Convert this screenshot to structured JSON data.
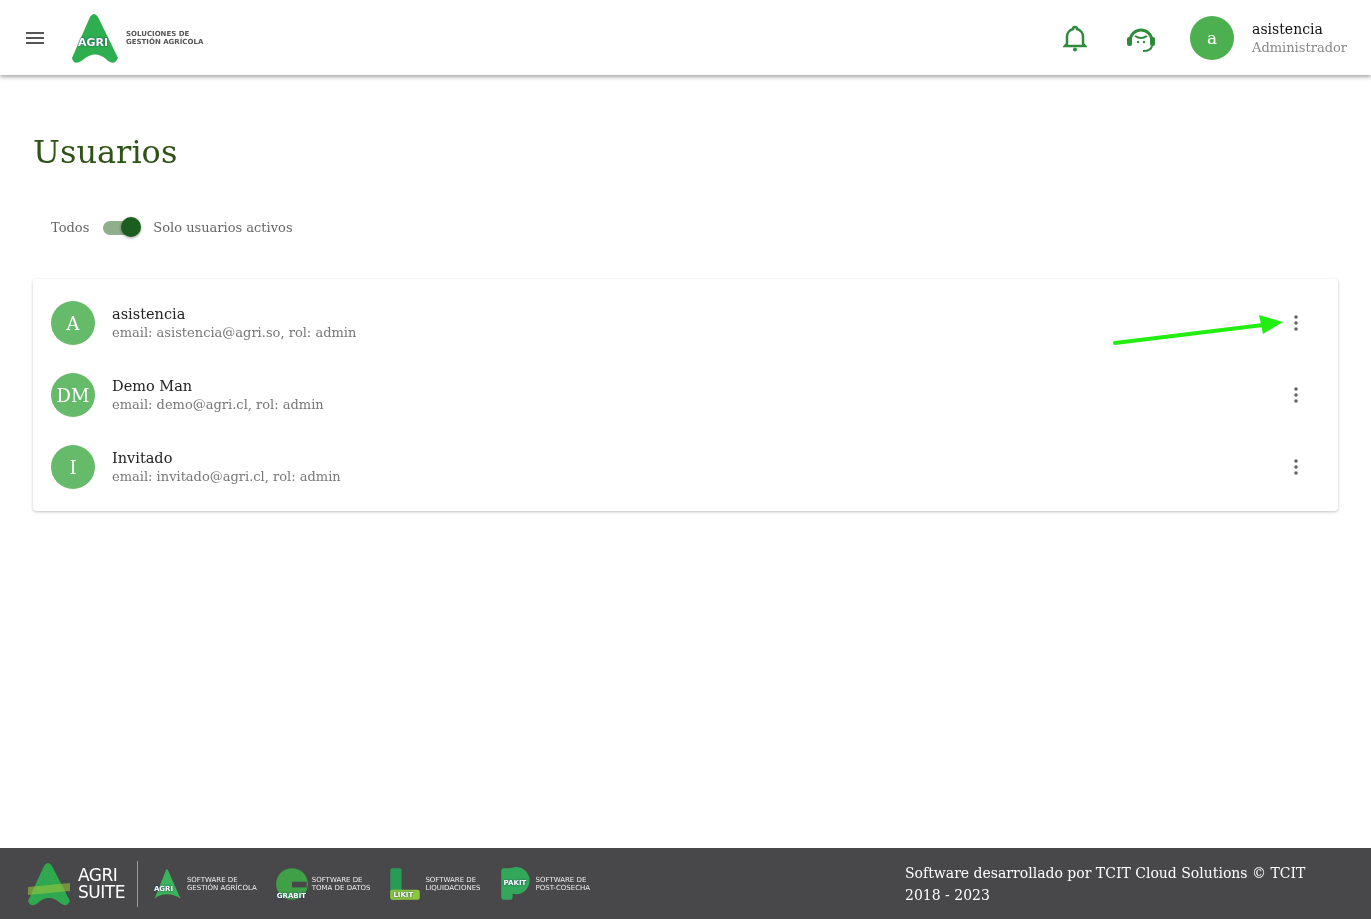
{
  "header": {
    "logo": {
      "mark": "AGRI",
      "line_1": "SOLUCIONES DE",
      "line_2": "GESTIÓN AGRÍCOLA"
    },
    "user": {
      "initial": "a",
      "name": "asistencia",
      "role": "Administrador"
    }
  },
  "page": {
    "title": "Usuarios",
    "filter": {
      "left_label": "Todos",
      "right_label": "Solo usuarios activos",
      "on": true
    }
  },
  "users": [
    {
      "initials": "A",
      "name": "asistencia",
      "details": "email: asistencia@agri.so, rol: admin"
    },
    {
      "initials": "DM",
      "name": "Demo Man",
      "details": "email: demo@agri.cl, rol: admin"
    },
    {
      "initials": "I",
      "name": "Invitado",
      "details": "email: invitado@agri.cl, rol: admin"
    }
  ],
  "footer": {
    "suite": {
      "line_1": "AGRI",
      "line_2": "SUITE"
    },
    "products": [
      {
        "mark": "AGRI",
        "line_1": "SOFTWARE DE",
        "line_2": "GESTIÓN AGRÍCOLA",
        "kind": "a"
      },
      {
        "mark": "GRABIT",
        "line_1": "SOFTWARE DE",
        "line_2": "TOMA DE DATOS",
        "kind": "g"
      },
      {
        "mark": "LIKIT",
        "line_1": "SOFTWARE DE",
        "line_2": "LIQUIDACIONES",
        "kind": "l"
      },
      {
        "mark": "PAKIT",
        "line_1": "SOFTWARE DE",
        "line_2": "POST-COSECHA",
        "kind": "p"
      }
    ],
    "credit": "Software desarrollado por TCIT Cloud Solutions © TCIT 2018 - 2023"
  }
}
